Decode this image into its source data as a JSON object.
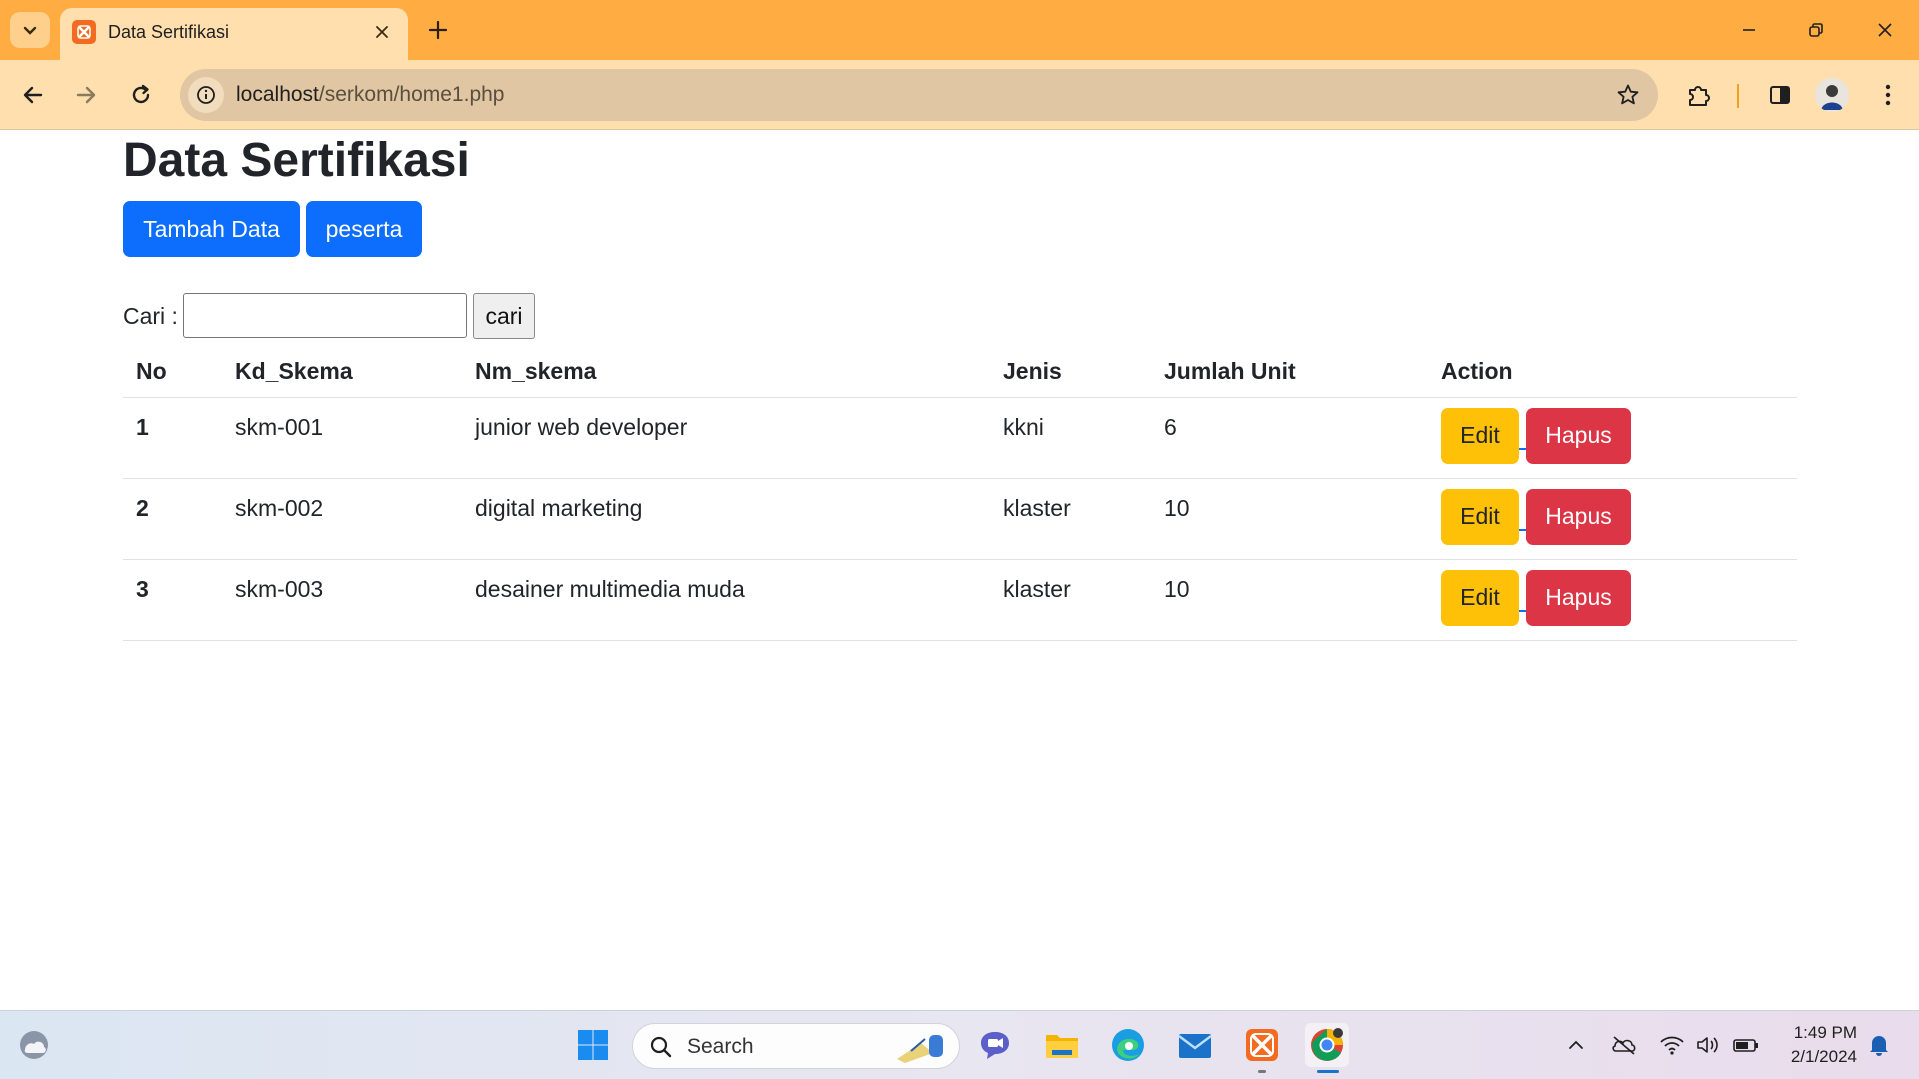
{
  "browser": {
    "tab_title": "Data Sertifikasi",
    "url_host": "localhost",
    "url_path": "/serkom/home1.php"
  },
  "page": {
    "title": "Data Sertifikasi",
    "add_button": "Tambah Data",
    "peserta_button": "peserta",
    "search_label": "Cari :",
    "search_value": "",
    "search_button": "cari"
  },
  "table": {
    "headers": [
      "No",
      "Kd_Skema",
      "Nm_skema",
      "Jenis",
      "Jumlah Unit",
      "Action"
    ],
    "rows": [
      {
        "no": "1",
        "kd": "skm-001",
        "nm": "junior web developer",
        "jenis": "kkni",
        "unit": "6",
        "edit": "Edit",
        "hapus": "Hapus"
      },
      {
        "no": "2",
        "kd": "skm-002",
        "nm": "digital marketing",
        "jenis": "klaster",
        "unit": "10",
        "edit": "Edit",
        "hapus": "Hapus"
      },
      {
        "no": "3",
        "kd": "skm-003",
        "nm": "desainer multimedia muda",
        "jenis": "klaster",
        "unit": "10",
        "edit": "Edit",
        "hapus": "Hapus"
      }
    ]
  },
  "taskbar": {
    "search_placeholder": "Search",
    "time": "1:49 PM",
    "date": "2/1/2024"
  },
  "colors": {
    "primary": "#0d6efd",
    "warning": "#ffc107",
    "danger": "#dc3545",
    "chrome_tabbar": "#ffad42",
    "chrome_toolbar": "#ffdfae"
  }
}
